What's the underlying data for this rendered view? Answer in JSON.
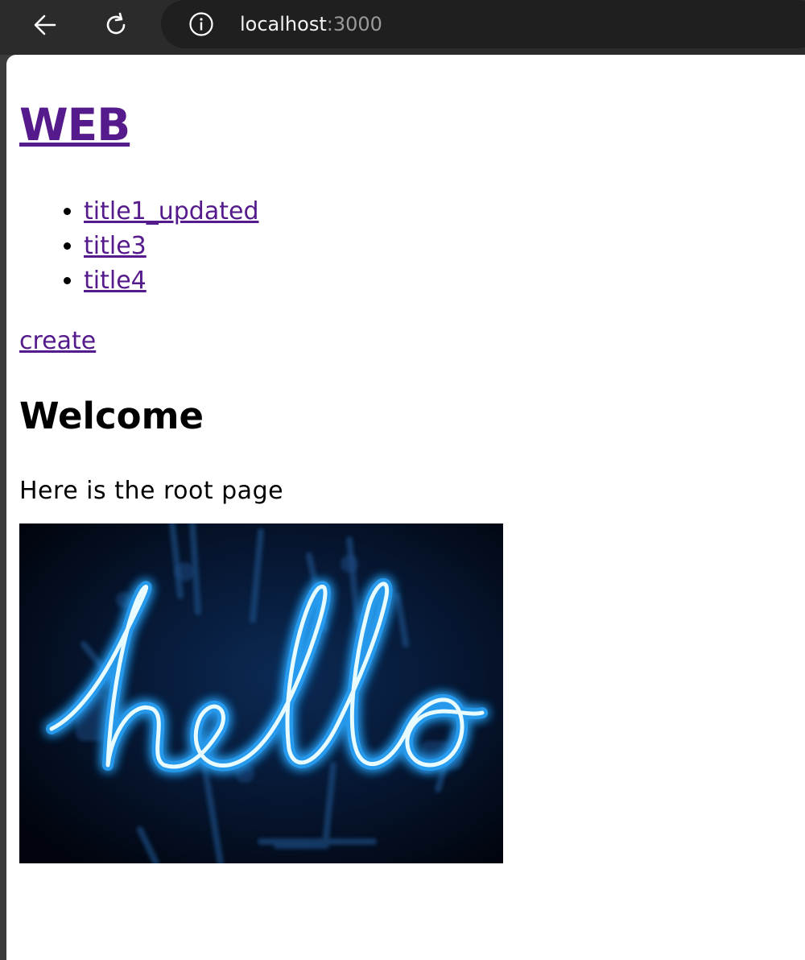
{
  "browser": {
    "back_icon": "arrow-left-icon",
    "reload_icon": "reload-icon",
    "info_icon": "info-icon",
    "url_host": "localhost",
    "url_port": ":3000"
  },
  "page": {
    "site_title": "WEB",
    "nav_links": [
      {
        "label": "title1_updated"
      },
      {
        "label": "title3"
      },
      {
        "label": "title4"
      }
    ],
    "create_label": "create",
    "heading": "Welcome",
    "description": "Here is the root page",
    "image_text": "hello"
  },
  "colors": {
    "link": "#551a8b",
    "browser_chrome": "#2b2b2b",
    "address_bar": "#1f1f1f",
    "neon": "#38b6ff"
  }
}
